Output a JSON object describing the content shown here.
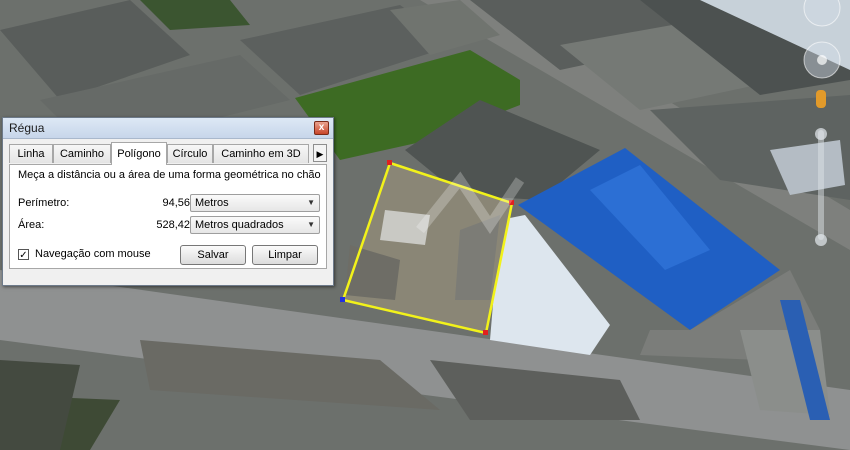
{
  "dialog": {
    "title": "Régua",
    "close_glyph": "x",
    "tabs": [
      {
        "label": "Linha"
      },
      {
        "label": "Caminho"
      },
      {
        "label": "Polígono",
        "active": true
      },
      {
        "label": "Círculo"
      },
      {
        "label": "Caminho em 3D"
      }
    ],
    "tab_scroll_glyph": "▶",
    "description": "Meça a distância ou a área de uma forma geométrica no chão",
    "perimeter": {
      "label": "Perímetro:",
      "value": "94,56",
      "unit": "Metros"
    },
    "area": {
      "label": "Área:",
      "value": "528,42",
      "unit": "Metros quadrados"
    },
    "mouse_nav": {
      "label": "Navegação com mouse",
      "checked": true,
      "check_glyph": "✓"
    },
    "save_label": "Salvar",
    "clear_label": "Limpar"
  },
  "map": {
    "polygon_color": "#f2f21a",
    "roof_color": "#1f5fc4"
  },
  "icons": [
    "close-icon",
    "dropdown-arrow-icon",
    "tab-scroll-right-icon",
    "checkmark-icon",
    "compass-icon",
    "zoom-slider-icon",
    "street-view-pegman-icon"
  ]
}
